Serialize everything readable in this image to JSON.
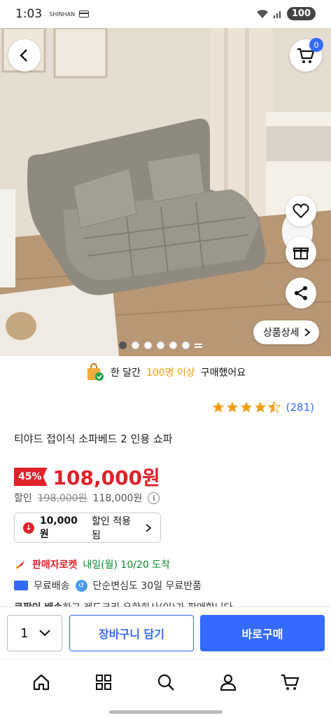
{
  "status": {
    "time": "1:03",
    "carrier_mini": "SHINHAN",
    "battery": "100"
  },
  "top": {
    "cart_count": "0"
  },
  "detail_button": "상품상세",
  "buyers": {
    "prefix": "한 달간",
    "highlight": "100명 이상",
    "suffix": "구매했어요"
  },
  "rating": {
    "stars": 4.5,
    "count": "(281)"
  },
  "product": {
    "title": "티야드 접이식 소파베드 2 인용 쇼파",
    "discount": "45%",
    "price": "108,000원",
    "orig_label": "할인",
    "orig_price": "198,000원",
    "coupon_price": "118,000원",
    "coupon_amount": "10,000원",
    "coupon_text": "할인 적용됨"
  },
  "delivery": {
    "rocket": "판매자로켓",
    "arrival": "내일(월) 10/20 도착",
    "free_ship": "무료배송",
    "return_text": "단순변심도 30일 무료반품",
    "seller_bold": "쿠팡이 배송",
    "seller_rest": "하고 레드크리 유한회사(이)가 판매합니다."
  },
  "buybar": {
    "qty": "1",
    "add_cart": "장바구니 담기",
    "buy_now": "바로구매"
  },
  "colors": {
    "accent": "#346aff",
    "price_red": "#e0212a",
    "green": "#0a8a2e"
  }
}
